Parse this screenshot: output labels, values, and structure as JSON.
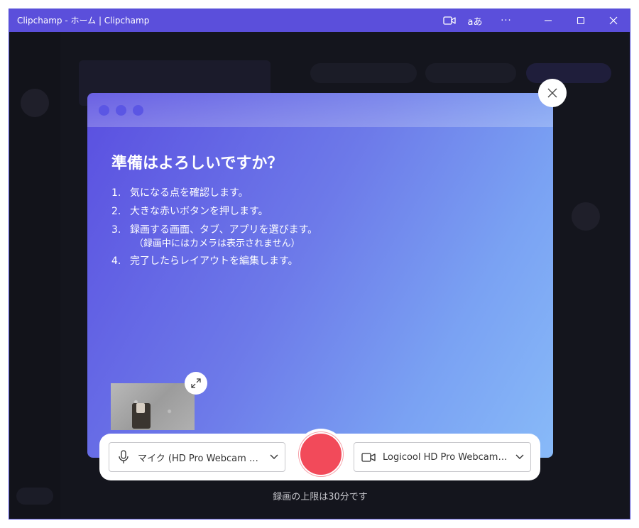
{
  "titlebar": {
    "title": "Clipchamp - ホーム | Clipchamp",
    "translate_label": "aあ",
    "more_label": "···"
  },
  "dialog": {
    "heading": "準備はよろしいですか？",
    "steps": [
      {
        "num": "1.",
        "text": "気になる点を確認します。"
      },
      {
        "num": "2.",
        "text": "大きな赤いボタンを押します。"
      },
      {
        "num": "3.",
        "text": "録画する画面、タブ、アプリを選びます。",
        "note": "（録画中にはカメラは表示されません）"
      },
      {
        "num": "4.",
        "text": "完了したらレイアウトを編集します。"
      }
    ]
  },
  "controls": {
    "microphone_label": "マイク (HD Pro Webcam C9...",
    "camera_label": "Logicool HD Pro Webcam ...",
    "limit_text": "録画の上限は30分です"
  },
  "colors": {
    "titlebar": "#5b4fdb",
    "record": "#f24a5a",
    "card_gradient_start": "#5a4fe0",
    "card_gradient_end": "#88baf8"
  }
}
